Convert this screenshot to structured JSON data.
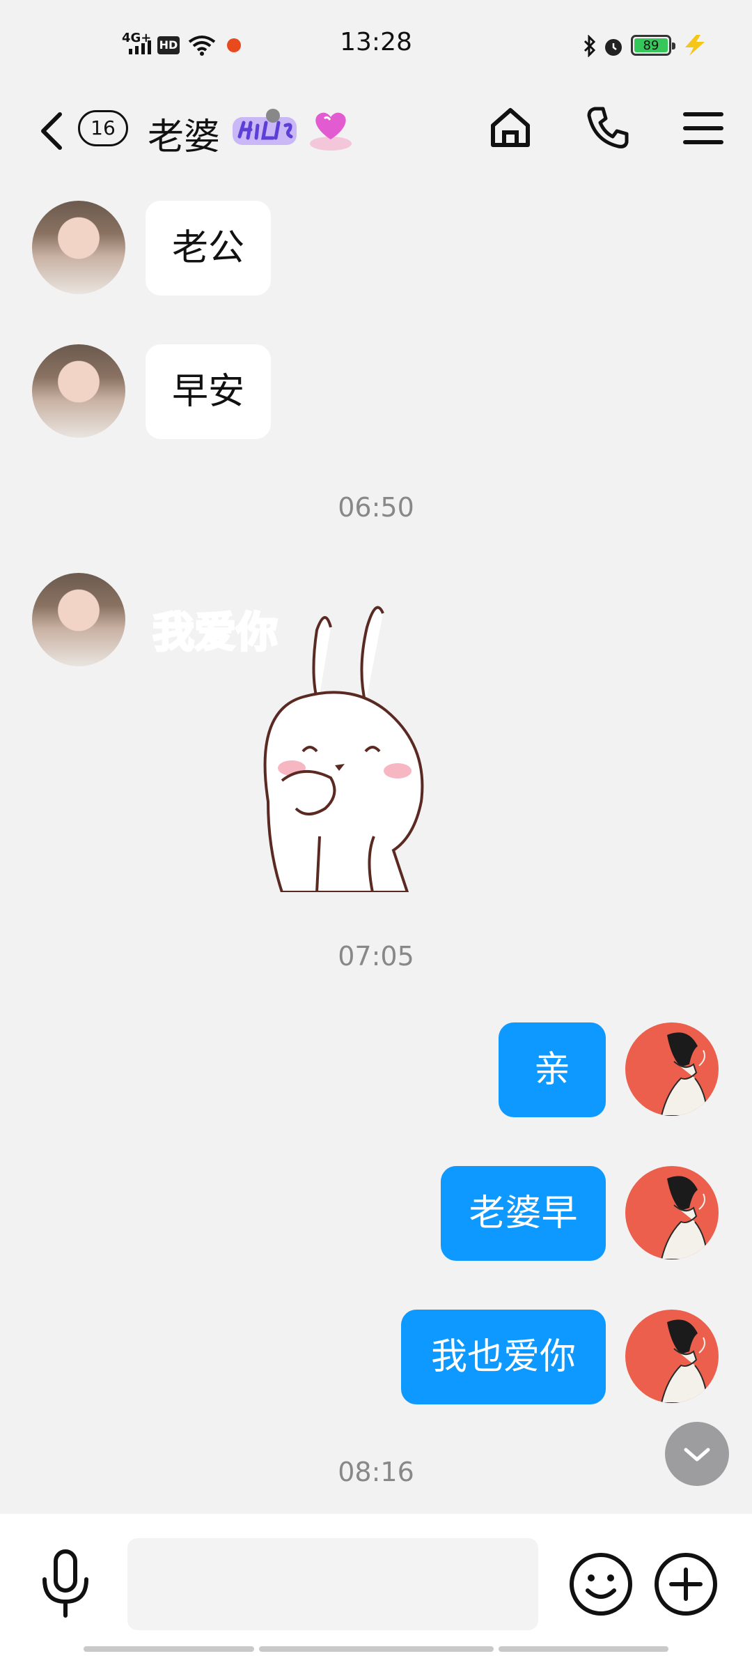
{
  "status_bar": {
    "time": "13:28",
    "network": "4G+",
    "hd": "HD",
    "battery": "89"
  },
  "header": {
    "unread_count": "16",
    "title": "老婆"
  },
  "messages": [
    {
      "side": "in",
      "text": "老公"
    },
    {
      "side": "in",
      "text": "早安"
    },
    {
      "timestamp": "06:50"
    },
    {
      "side": "in",
      "sticker": "rabbit-i-love-you",
      "sticker_text": "我爱你"
    },
    {
      "timestamp": "07:05"
    },
    {
      "side": "out",
      "text": "亲"
    },
    {
      "side": "out",
      "text": "老婆早"
    },
    {
      "side": "out",
      "text": "我也爱你"
    },
    {
      "timestamp": "08:16"
    }
  ],
  "colors": {
    "outgoing_bubble": "#0d99ff",
    "incoming_bubble": "#ffffff",
    "background": "#f2f2f3"
  },
  "input": {
    "placeholder": ""
  }
}
